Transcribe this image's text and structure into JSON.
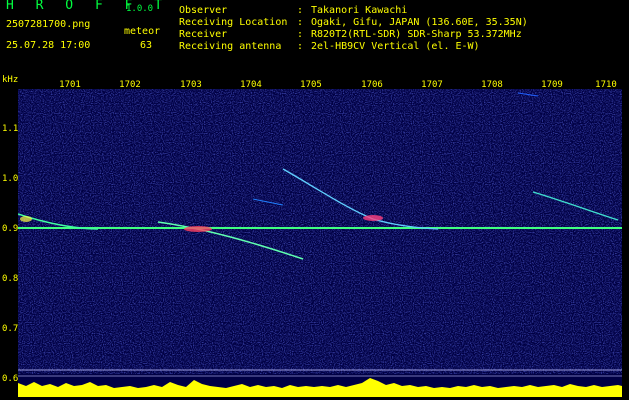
{
  "header": {
    "title": "H R O F F T",
    "version": "1.0.0",
    "file": "2507281700.png",
    "datetime": "25.07.28 17:00",
    "meteor_label": "meteor",
    "meteor_count": "63"
  },
  "info": [
    {
      "key": "Observer",
      "sep": ":",
      "value": "Takanori Kawachi"
    },
    {
      "key": "Receiving Location",
      "sep": ":",
      "value": "Ogaki, Gifu, JAPAN (136.60E, 35.35N)"
    },
    {
      "key": "Receiver",
      "sep": ":",
      "value": "R820T2(RTL-SDR) SDR-Sharp 53.372MHz"
    },
    {
      "key": "Receiving antenna",
      "sep": ":",
      "value": "2el-HB9CV Vertical (el. E-W)"
    }
  ],
  "axis": {
    "unit": "kHz",
    "x_ticks": [
      "1701",
      "1702",
      "1703",
      "1704",
      "1705",
      "1706",
      "1707",
      "1708",
      "1709",
      "1710"
    ],
    "y_ticks": [
      "1.1",
      "1.0",
      "0.9",
      "0.8",
      "0.7",
      "0.6"
    ]
  },
  "colors": {
    "background": "#000000",
    "plot_background": "#000044",
    "carrier": "#40ff80",
    "histogram": "#ffff00",
    "baseline": "#00e0ff",
    "text": "#ffff00",
    "title": "#00ff40"
  }
}
